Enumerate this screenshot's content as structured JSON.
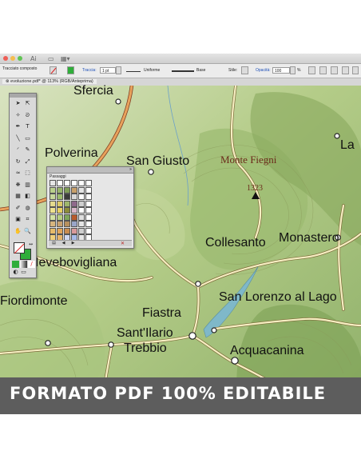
{
  "window": {
    "traffic_lights": [
      "#ee5f57",
      "#f5bd4f",
      "#60c453"
    ],
    "toolbar_icons": [
      "ai-logo-icon",
      "document-icon",
      "arrange-icon"
    ]
  },
  "control_bar": {
    "selection_label": "Tracciato composto",
    "stroke_label": "Traccia:",
    "stroke_weight": "1 pt",
    "stroke_profile": "Uniforme",
    "brush_label": "Base",
    "style_label": "Stile:",
    "opacity_label": "Opacità:",
    "opacity_value": "100",
    "opacity_unit": "%"
  },
  "document_tab": {
    "title": "evoluzione.pdf* @ 113% (RGB/Anteprima)"
  },
  "map": {
    "places": [
      "Sfercia",
      "Polverina",
      "San Giusto",
      "Monte Fiegni",
      "1323",
      "La",
      "Collesanto",
      "Monastero",
      "Ievebovigliana",
      "Fiordimonte",
      "Fiastra",
      "San Lorenzo al Lago",
      "Sant'Ilario",
      "Trebbio",
      "Acquacanina",
      "1275"
    ],
    "colors": {
      "base_green": "#b9cf8d",
      "relief_dark": "#8fb06a",
      "road": "#f6efc2",
      "road_edge": "#7d6a3a",
      "main_road": "#e8a25c",
      "lake": "#7fb8c9",
      "label_brown": "#6b2a1a"
    }
  },
  "tools_panel": {
    "icons": [
      "selection-icon",
      "direct-selection-icon",
      "magic-wand-icon",
      "lasso-icon",
      "pen-icon",
      "type-icon",
      "line-icon",
      "rectangle-icon",
      "brush-icon",
      "pencil-icon",
      "rotate-icon",
      "scale-icon",
      "warp-icon",
      "free-transform-icon",
      "symbol-icon",
      "graph-icon",
      "mesh-icon",
      "gradient-icon",
      "eyedropper-icon",
      "blend-icon",
      "artboard-icon",
      "slice-icon",
      "hand-icon",
      "zoom-icon"
    ],
    "fill_color": "#2fae3a",
    "stroke_color": "#ffffff"
  },
  "swatches_panel": {
    "tab_label": "Passaggi",
    "rows": [
      [
        "#e6e6e6",
        "#ffffff",
        "#ffffff",
        "#ffffff",
        "#ffffff",
        "#ffffff"
      ],
      [
        "#b9d08b",
        "#98b46a",
        "#7f9c58",
        "#c8a06a",
        "#e6e6e6",
        "#ffffff"
      ],
      [
        "#c7d89b",
        "#9cbb6d",
        "#3a3a3a",
        "#d8d8d8",
        "#ffffff",
        "#ffffff"
      ],
      [
        "#e5da8d",
        "#dcca68",
        "#9eb66c",
        "#8f6a8c",
        "#cfcfcf",
        "#ffffff"
      ],
      [
        "#eee28f",
        "#e5cf62",
        "#8c8c3a",
        "#d9b7c9",
        "#ffffff",
        "#ffffff"
      ],
      [
        "#d3e2a3",
        "#b6ce81",
        "#7ea65b",
        "#b85a2b",
        "#e0e0e0",
        "#ffffff"
      ],
      [
        "#d7b57e",
        "#c7a170",
        "#b7905e",
        "#9aa6c8",
        "#e6e6e6",
        "#ffffff"
      ],
      [
        "#e6bb6a",
        "#e0a55a",
        "#c98c4f",
        "#d99a9a",
        "#cfcfcf",
        "#ffffff"
      ],
      [
        "#f0cf7a",
        "#e6b46b",
        "#cfd7ef",
        "#a6bbe8",
        "#e6e6e6",
        "#ffffff"
      ]
    ]
  },
  "banner": {
    "text": "FORMATO PDF 100% EDITABILE"
  }
}
